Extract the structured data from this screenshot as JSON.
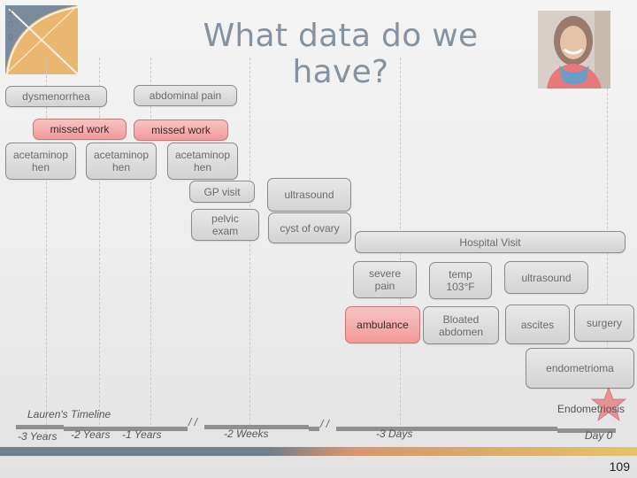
{
  "slide": {
    "title": "What data do we have?",
    "side_number": [
      "1",
      "0",
      "9"
    ],
    "page_number": "109",
    "photo_alt": "portrait-photo"
  },
  "colors": {
    "title": "#8593a0",
    "box_gray": "#d9d9d9",
    "box_red": "#f4a8a8",
    "bar_left": "#6f7f8c",
    "bar_right": "#e2c56a",
    "logo_blue": "#7a8c9c",
    "logo_gold": "#e9b76f",
    "star": "#e88a8a"
  },
  "events": {
    "dysmenorrhea": "dysmenorrhea",
    "abdominal_pain": "abdominal pain",
    "missed_work_1": "missed work",
    "missed_work_2": "missed work",
    "acetaminophen_1_a": "acetaminop",
    "acetaminophen_1_b": "hen",
    "acetaminophen_2_a": "acetaminop",
    "acetaminophen_2_b": "hen",
    "acetaminophen_3_a": "acetaminop",
    "acetaminophen_3_b": "hen",
    "gp_visit": "GP visit",
    "ultrasound_1": "ultrasound",
    "pelvic_exam_a": "pelvic",
    "pelvic_exam_b": "exam",
    "cyst_of_ovary": "cyst of ovary",
    "hospital_visit": "Hospital Visit",
    "severe_pain_a": "severe",
    "severe_pain_b": "pain",
    "temp_a": "temp",
    "temp_b": "103°F",
    "ultrasound_2": "ultrasound",
    "ambulance": "ambulance",
    "bloated_a": "Bloated",
    "bloated_b": "abdomen",
    "ascites": "ascites",
    "surgery": "surgery",
    "endometrioma": "endometrioma",
    "endometriosis": "Endometriosis"
  },
  "timeline": {
    "title": "Lauren's Timeline",
    "labels": [
      "-3 Years",
      "-2 Years",
      "-1 Years",
      "-2 Weeks",
      "-3 Days",
      "Day 0"
    ],
    "break_mark": "/ /"
  }
}
